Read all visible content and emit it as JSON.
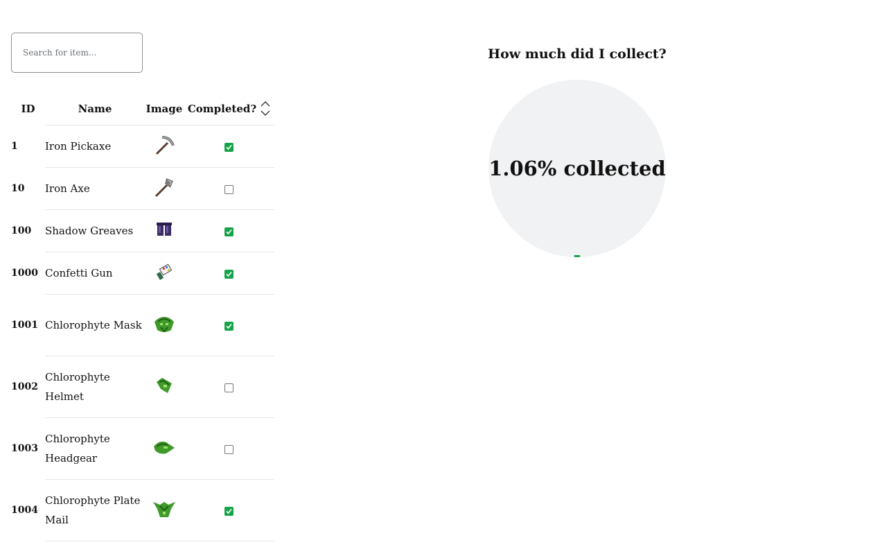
{
  "search": {
    "placeholder": "Search for item..."
  },
  "table": {
    "columns": {
      "id": "ID",
      "name": "Name",
      "image": "Image",
      "completed": "Completed?"
    },
    "rows": [
      {
        "id": "1",
        "name": "Iron Pickaxe",
        "icon": "iron-pickaxe-icon",
        "completed": true
      },
      {
        "id": "10",
        "name": "Iron Axe",
        "icon": "iron-axe-icon",
        "completed": false
      },
      {
        "id": "100",
        "name": "Shadow Greaves",
        "icon": "shadow-greaves-icon",
        "completed": true
      },
      {
        "id": "1000",
        "name": "Confetti Gun",
        "icon": "confetti-gun-icon",
        "completed": true
      },
      {
        "id": "1001",
        "name": "Chlorophyte Mask",
        "icon": "chlorophyte-mask-icon",
        "completed": true
      },
      {
        "id": "1002",
        "name": "Chlorophyte Helmet",
        "icon": "chlorophyte-helmet-icon",
        "completed": false
      },
      {
        "id": "1003",
        "name": "Chlorophyte Headgear",
        "icon": "chlorophyte-headgear-icon",
        "completed": false
      },
      {
        "id": "1004",
        "name": "Chlorophyte Plate Mail",
        "icon": "chlorophyte-plate-mail-icon",
        "completed": true
      }
    ]
  },
  "progress": {
    "title": "How much did I collect?",
    "label": "1.06% collected",
    "fraction": 0.0106,
    "colors": {
      "track": "#f1f2f4",
      "fill": "#16a34a"
    }
  },
  "colors": {
    "checked": "#16a34a"
  }
}
